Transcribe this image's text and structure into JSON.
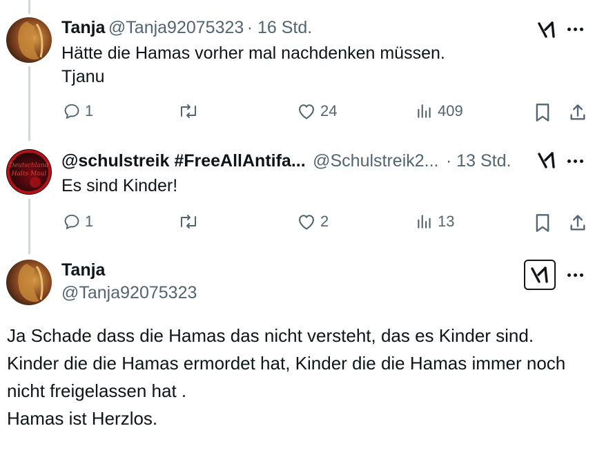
{
  "tweets": [
    {
      "name": "Tanja",
      "handle": "@Tanja92075323",
      "time": "· 16 Std.",
      "text": "Hätte die Hamas vorher mal nachdenken müssen.\nTjanu",
      "replies": "1",
      "likes": "24",
      "views": "409"
    },
    {
      "name": "@schulstreik #FreeAllAntifa...",
      "handle": "@Schulstreik2...",
      "time": "· 13 Std.",
      "text": "Es sind Kinder!",
      "replies": "1",
      "likes": "2",
      "views": "13",
      "avatar_text": "Deutschland Halts Maul"
    }
  ],
  "main_tweet": {
    "name": "Tanja",
    "handle": "@Tanja92075323",
    "text": "Ja Schade dass die Hamas das nicht versteht, das es Kinder sind.\nKinder die die Hamas ermordet hat, Kinder die die Hamas immer noch nicht freigelassen hat .\nHamas ist Herzlos."
  },
  "colors": {
    "text": "#0f1419",
    "secondary": "#536471",
    "thread_line": "#cfd9de",
    "avatar2_bg": "#b3121a"
  },
  "icons": [
    "grok-icon",
    "more-icon",
    "reply-icon",
    "retweet-icon",
    "like-icon",
    "views-icon",
    "bookmark-icon",
    "share-icon"
  ]
}
